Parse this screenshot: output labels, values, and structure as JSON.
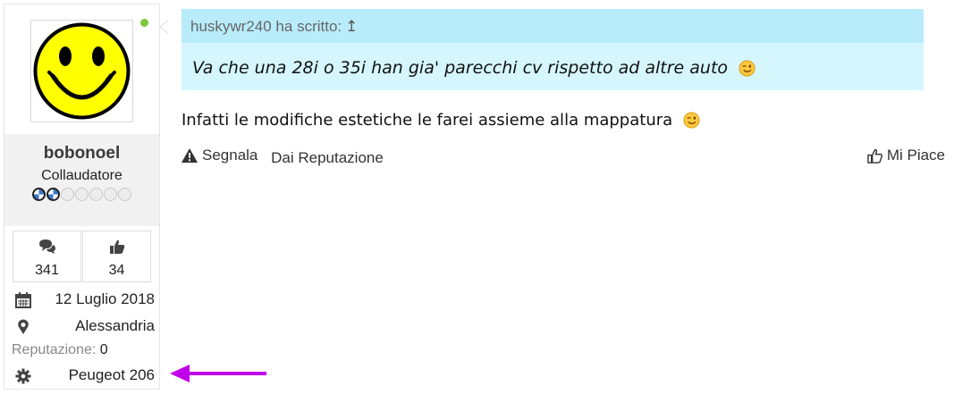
{
  "user": {
    "username": "bobonoel",
    "title": "Collaudatore",
    "online": true,
    "rank": {
      "filled": 2,
      "total": 7
    },
    "stats": {
      "posts": "341",
      "likes": "34"
    },
    "joined": "12 Luglio 2018",
    "location": "Alessandria",
    "reputation_label": "Reputazione:",
    "reputation_value": "0",
    "car": "Peugeot 206"
  },
  "quote": {
    "header": "huskywr240 ha scritto:",
    "jump_glyph": "↥",
    "text": "Va che una 28i o 35i han gia' parecchi cv rispetto ad altre auto"
  },
  "post": {
    "text": "Infatti le modifiche estetiche le farei assieme alla mappatura"
  },
  "actions": {
    "report": "Segnala",
    "reputation": "Dai Reputazione",
    "like": "Mi Piace"
  },
  "icons": {
    "avatar": "smiley-avatar-icon",
    "online": "online-dot-icon",
    "posts": "comments-icon",
    "likes": "thumbs-up-icon",
    "joined": "calendar-icon",
    "location": "map-marker-icon",
    "car": "gear-icon",
    "report": "warning-icon",
    "like": "thumbs-up-outline-icon",
    "emoji": "wink-emoji-icon"
  },
  "colors": {
    "quote_header_bg": "#b8ecfb",
    "quote_body_bg": "#d5f6fd",
    "online": "#7cc73a",
    "annotation_arrow": "#c000e8"
  }
}
